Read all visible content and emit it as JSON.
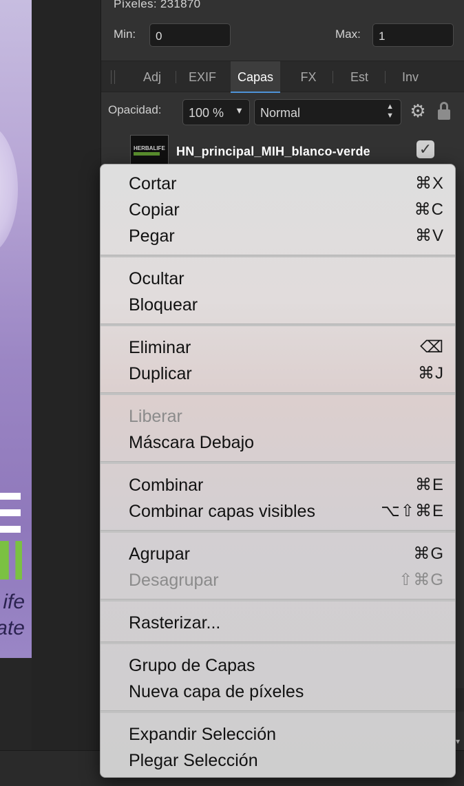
{
  "canvas": {
    "word_1": "ife",
    "word_2": "ate"
  },
  "panel": {
    "pixel_info": "Píxeles: 231870",
    "min_label": "Min:",
    "min_value": "0",
    "max_label": "Max:",
    "max_value": "1",
    "tabs": [
      {
        "label": "Adj"
      },
      {
        "label": "EXIF"
      },
      {
        "label": "Capas",
        "active": true
      },
      {
        "label": "FX"
      },
      {
        "label": "Est"
      },
      {
        "label": "Inv"
      }
    ],
    "opacity_label": "Opacidad:",
    "opacity_value": "100 %",
    "blend_mode": "Normal",
    "layer_name": "HN_principal_MIH_blanco-verde",
    "layer_thumb_text": "HERBALIFE"
  },
  "context_menu": {
    "items": [
      {
        "label": "Cortar",
        "shortcut": "⌘X",
        "disabled": false
      },
      {
        "label": "Copiar",
        "shortcut": "⌘C",
        "disabled": false
      },
      {
        "label": "Pegar",
        "shortcut": "⌘V",
        "disabled": false
      },
      {
        "label": "Ocultar",
        "shortcut": "",
        "disabled": false
      },
      {
        "label": "Bloquear",
        "shortcut": "",
        "disabled": false
      },
      {
        "label": "Eliminar",
        "shortcut": "⌫",
        "disabled": false
      },
      {
        "label": "Duplicar",
        "shortcut": "⌘J",
        "disabled": false
      },
      {
        "label": "Liberar",
        "shortcut": "",
        "disabled": true
      },
      {
        "label": "Máscara Debajo",
        "shortcut": "",
        "disabled": false
      },
      {
        "label": "Combinar",
        "shortcut": "⌘E",
        "disabled": false
      },
      {
        "label": "Combinar capas visibles",
        "shortcut": "⌥⇧⌘E",
        "disabled": false
      },
      {
        "label": "Agrupar",
        "shortcut": "⌘G",
        "disabled": false
      },
      {
        "label": "Desagrupar",
        "shortcut": "⇧⌘G",
        "disabled": true
      },
      {
        "label": "Rasterizar...",
        "shortcut": "",
        "disabled": false
      },
      {
        "label": "Grupo de Capas",
        "shortcut": "",
        "disabled": false
      },
      {
        "label": "Nueva capa de píxeles",
        "shortcut": "",
        "disabled": false
      },
      {
        "label": "Expandir Selección",
        "shortcut": "",
        "disabled": false
      },
      {
        "label": "Plegar Selección",
        "shortcut": "",
        "disabled": false
      }
    ]
  },
  "colors": {
    "panel_bg": "#323232",
    "accent": "#4e93d9",
    "brand_green": "#7bc142",
    "menu_text": "#111111",
    "menu_disabled": "#8b8b8b"
  }
}
